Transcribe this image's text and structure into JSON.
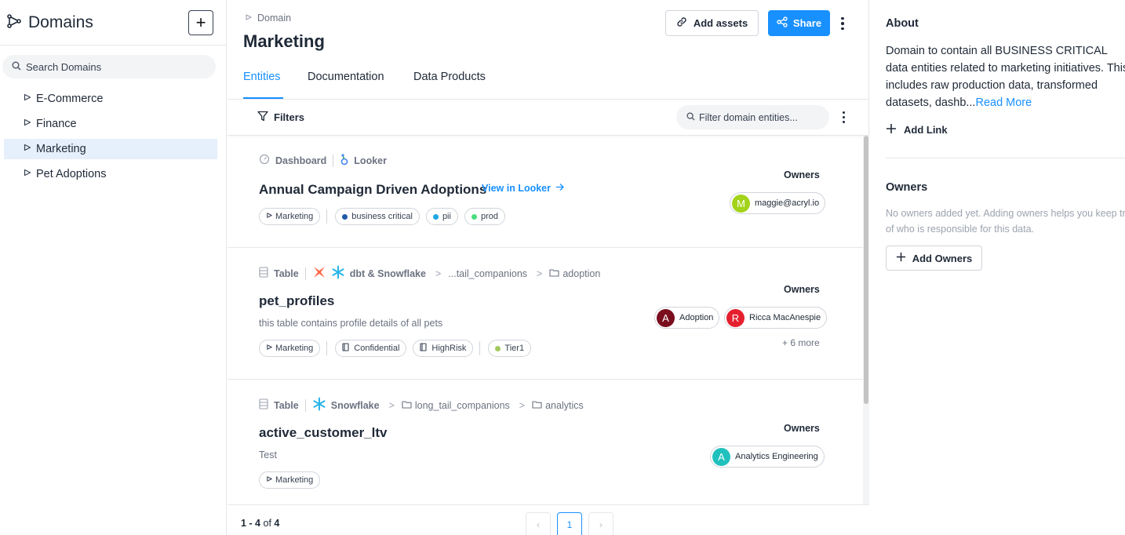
{
  "sidebar": {
    "title": "Domains",
    "add_icon": "+",
    "search_placeholder": "Search Domains",
    "items": [
      {
        "label": "E-Commerce"
      },
      {
        "label": "Finance"
      },
      {
        "label": "Marketing",
        "active": true
      },
      {
        "label": "Pet Adoptions"
      }
    ]
  },
  "header": {
    "breadcrumb": "Domain",
    "title": "Marketing",
    "add_assets_label": "Add assets",
    "share_label": "Share"
  },
  "tabs": [
    "Entities",
    "Documentation",
    "Data Products"
  ],
  "active_tab": "Entities",
  "filterbar": {
    "filters_label": "Filters",
    "search_placeholder": "Filter domain entities..."
  },
  "results": [
    {
      "type": "Dashboard",
      "platform": "Looker",
      "name": "Annual Campaign Driven Adoptions",
      "view_link": "View in Looker",
      "domain_tag": "Marketing",
      "tags": [
        {
          "label": "business critical",
          "color": "#1e5aa8"
        },
        {
          "label": "pii",
          "color": "#1ea7e4"
        },
        {
          "label": "prod",
          "color": "#4ade80"
        }
      ],
      "owners_label": "Owners",
      "owners": [
        {
          "initial": "M",
          "name": "maggie@acryl.io",
          "color": "#a3d31a"
        }
      ]
    },
    {
      "type": "Table",
      "platform": "dbt & Snowflake",
      "path": [
        "...tail_companions",
        "adoption"
      ],
      "name": "pet_profiles",
      "description": "this table contains profile details of all pets",
      "domain_tag": "Marketing",
      "terms": [
        "Confidential",
        "HighRisk"
      ],
      "tags": [
        {
          "label": "Tier1",
          "color": "#a3c95d"
        }
      ],
      "owners_label": "Owners",
      "owners": [
        {
          "initial": "A",
          "name": "Adoption",
          "color": "#7a0e1e"
        },
        {
          "initial": "R",
          "name": "Ricca MacAnespie",
          "color": "#e5202e"
        }
      ],
      "more_owners": "+ 6 more"
    },
    {
      "type": "Table",
      "platform": "Snowflake",
      "path": [
        "long_tail_companions",
        "analytics"
      ],
      "name": "active_customer_ltv",
      "description": "Test",
      "domain_tag": "Marketing",
      "owners_label": "Owners",
      "owners": [
        {
          "initial": "A",
          "name": "Analytics Engineering",
          "color": "#20c1bd"
        }
      ]
    }
  ],
  "pagination": {
    "range": "1 - 4",
    "of": "of",
    "total": "4",
    "current_page": "1",
    "prev_icon": "‹",
    "next_icon": "›"
  },
  "about": {
    "title": "About",
    "text": "Domain to contain all BUSINESS CRITICAL data entities related to marketing initiatives. This includes raw production data, transformed datasets, dashb...",
    "read_more": "Read More",
    "add_link_label": "Add Link"
  },
  "owners_panel": {
    "title": "Owners",
    "empty_line1": "No owners added yet. Adding owners helps you keep tra",
    "empty_line2": "of who is responsible for this data.",
    "add_owners_label": "Add Owners"
  },
  "colors": {
    "accent": "#1890ff",
    "active_bg": "#e6f0fc"
  }
}
